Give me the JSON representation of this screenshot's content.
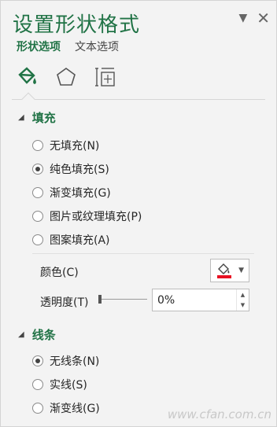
{
  "pane": {
    "title": "设置形状格式",
    "tabs": [
      {
        "label": "形状选项",
        "active": true
      },
      {
        "label": "文本选项",
        "active": false
      }
    ],
    "icon_tabs": [
      "fill-line-icon",
      "effects-pentagon-icon",
      "size-properties-icon"
    ]
  },
  "fill_section": {
    "header": "填充",
    "options": [
      {
        "label": "无填充(N)",
        "checked": false
      },
      {
        "label": "纯色填充(S)",
        "checked": true
      },
      {
        "label": "渐变填充(G)",
        "checked": false
      },
      {
        "label": "图片或纹理填充(P)",
        "checked": false
      },
      {
        "label": "图案填充(A)",
        "checked": false
      }
    ],
    "color_label": "颜色(C)",
    "color_value": "#e81123",
    "transparency_label": "透明度(T)",
    "transparency_value": "0%"
  },
  "line_section": {
    "header": "线条",
    "options": [
      {
        "label": "无线条(N)",
        "checked": true
      },
      {
        "label": "实线(S)",
        "checked": false
      },
      {
        "label": "渐变线(G)",
        "checked": false
      }
    ]
  },
  "watermark": "www.cfan.com.cn",
  "colors": {
    "accent": "#217346"
  }
}
